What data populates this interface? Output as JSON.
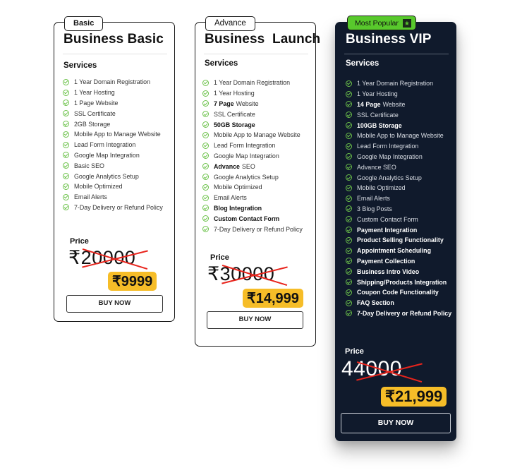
{
  "plans": [
    {
      "tag": "Basic",
      "title": "Business Basic",
      "services_heading": "Services",
      "features": [
        {
          "bold": "",
          "text": "1 Year Domain Registration"
        },
        {
          "bold": "",
          "text": "1 Year Hosting"
        },
        {
          "bold": "",
          "text": "1 Page Website"
        },
        {
          "bold": "",
          "text": "SSL Certificate"
        },
        {
          "bold": "",
          "text": "2GB Storage"
        },
        {
          "bold": "",
          "text": "Mobile App to Manage Website"
        },
        {
          "bold": "",
          "text": "Lead Form Integration"
        },
        {
          "bold": "",
          "text": "Google Map Integration"
        },
        {
          "bold": "",
          "text": "Basic SEO"
        },
        {
          "bold": "",
          "text": "Google Analytics Setup"
        },
        {
          "bold": "",
          "text": "Mobile Optimized"
        },
        {
          "bold": "",
          "text": "Email Alerts"
        },
        {
          "bold": "",
          "text": "7-Day Delivery or Refund Policy"
        }
      ],
      "price_label": "Price",
      "old_price": "₹20000",
      "new_price": "₹9999",
      "buy_label": "BUY NOW"
    },
    {
      "tag": "Advance",
      "title": "Business  Launch",
      "services_heading": "Services",
      "features": [
        {
          "bold": "",
          "text": "1 Year Domain Registration"
        },
        {
          "bold": "",
          "text": "1 Year Hosting"
        },
        {
          "bold": "7 Page",
          "text": "Website"
        },
        {
          "bold": "",
          "text": "SSL Certificate"
        },
        {
          "bold": "50GB Storage",
          "text": ""
        },
        {
          "bold": "",
          "text": "Mobile App to Manage Website"
        },
        {
          "bold": "",
          "text": "Lead Form Integration"
        },
        {
          "bold": "",
          "text": "Google Map Integration"
        },
        {
          "bold": "Advance",
          "text": "SEO"
        },
        {
          "bold": "",
          "text": "Google Analytics Setup"
        },
        {
          "bold": "",
          "text": "Mobile Optimized"
        },
        {
          "bold": "",
          "text": "Email Alerts"
        },
        {
          "bold": "Blog Integration",
          "text": ""
        },
        {
          "bold": "Custom Contact Form",
          "text": ""
        },
        {
          "bold": "",
          "text": "7-Day Delivery or Refund Policy"
        }
      ],
      "price_label": "Price",
      "old_price": "₹30000",
      "new_price": "₹14,999",
      "buy_label": "BUY NOW"
    },
    {
      "tag": "Most Popular",
      "tag_icon": "star-icon",
      "title": "Business VIP",
      "services_heading": "Services",
      "features": [
        {
          "bold": "",
          "text": "1 Year Domain Registration"
        },
        {
          "bold": "",
          "text": "1 Year Hosting"
        },
        {
          "bold": "14 Page",
          "text": "Website"
        },
        {
          "bold": "",
          "text": "SSL Certificate"
        },
        {
          "bold": "100GB Storage",
          "text": ""
        },
        {
          "bold": "",
          "text": "Mobile App to Manage Website"
        },
        {
          "bold": "",
          "text": "Lead Form Integration"
        },
        {
          "bold": "",
          "text": "Google Map Integration"
        },
        {
          "bold": "",
          "text": "Advance SEO"
        },
        {
          "bold": "",
          "text": "Google Analytics Setup"
        },
        {
          "bold": "",
          "text": "Mobile Optimized"
        },
        {
          "bold": "",
          "text": "Email Alerts"
        },
        {
          "bold": "",
          "text": "3 Blog Posts"
        },
        {
          "bold": "",
          "text": "Custom Contact Form"
        },
        {
          "bold": "Payment Integration",
          "text": ""
        },
        {
          "bold": "Product Selling Functionality",
          "text": ""
        },
        {
          "bold": "Appointment Scheduling",
          "text": ""
        },
        {
          "bold": "Payment Collection",
          "text": ""
        },
        {
          "bold": "Business Intro Video",
          "text": ""
        },
        {
          "bold": "Shipping/Products Integration",
          "text": ""
        },
        {
          "bold": "Coupon Code Functionality",
          "text": ""
        },
        {
          "bold": "FAQ Section",
          "text": ""
        },
        {
          "bold": "7-Day Delivery or Refund Policy",
          "text": ""
        }
      ],
      "price_label": "Price",
      "old_price": "44000",
      "new_price": "₹21,999",
      "buy_label": "BUY NOW"
    }
  ],
  "colors": {
    "check_green": "#6cc24a",
    "popular_green": "#58c92c",
    "price_badge_yellow": "#f6bd28",
    "strike_red": "#e8241c",
    "vip_bg": "#101a2c"
  }
}
